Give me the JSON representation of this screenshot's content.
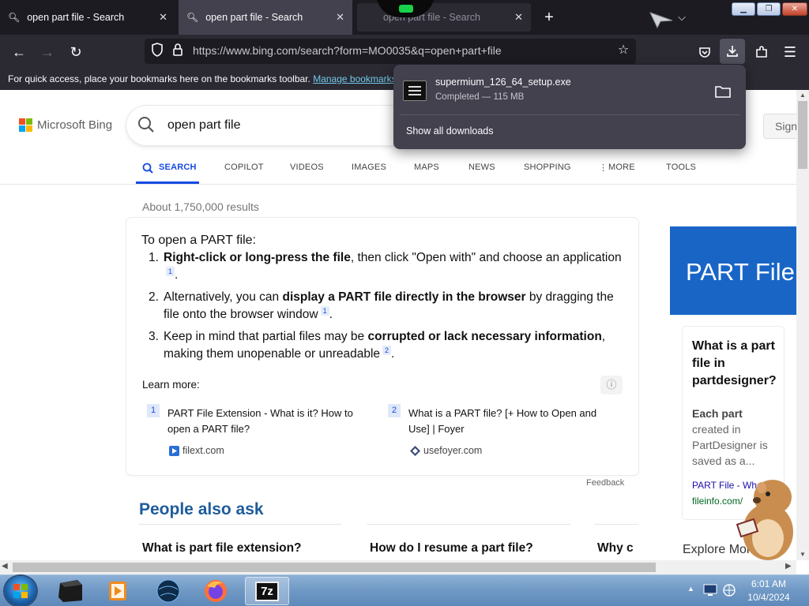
{
  "browser": {
    "tabs": [
      {
        "title": "open part file - Search",
        "icon": "search-icon",
        "active": false
      },
      {
        "title": "open part file - Search",
        "icon": "search-icon",
        "active": true
      },
      {
        "title": "open part file - Search",
        "icon": "spyware-icon",
        "active": false
      }
    ],
    "url": "https://www.bing.com/search?form=MO0035&q=open+part+file",
    "bookmarks_bar": {
      "text": "For quick access, place your bookmarks here on the bookmarks toolbar.",
      "link": "Manage bookmarks..."
    }
  },
  "downloads": {
    "filename": "supermium_126_64_setup.exe",
    "status": "Completed — 115 MB",
    "show_all": "Show all downloads"
  },
  "bing": {
    "logo": "Microsoft Bing",
    "query": "open part file",
    "sign_in": "Sign in",
    "scopes": [
      "SEARCH",
      "COPILOT",
      "VIDEOS",
      "IMAGES",
      "MAPS",
      "NEWS",
      "SHOPPING",
      "MORE",
      "TOOLS"
    ],
    "result_count": "About 1,750,000 results",
    "answer": {
      "intro": "To open a PART file:",
      "steps": [
        {
          "num": "1.",
          "bold": "Right-click or long-press the file",
          "rest": ", then click \"Open with\" and choose an application",
          "cite": "1",
          "tail": "."
        },
        {
          "num": "2.",
          "pre": "Alternatively, you can ",
          "bold": "display a PART file directly in the browser",
          "rest": " by dragging the file onto the browser window",
          "cite": "1",
          "tail": "."
        },
        {
          "num": "3.",
          "pre": "Keep in mind that partial files may be ",
          "bold": "corrupted or lack necessary information",
          "rest": ", making them unopenable or unreadable",
          "cite": "2",
          "tail": "."
        }
      ],
      "learn_more": "Learn more:",
      "refs": [
        {
          "num": "1",
          "title": "PART File Extension - What is it? How to open a PART file?",
          "site": "filext.com"
        },
        {
          "num": "2",
          "title": "What is a PART file? [+ How to Open and Use] | Foyer",
          "site": "usefoyer.com"
        }
      ],
      "feedback": "Feedback"
    },
    "people_also_ask": {
      "title": "People also ask",
      "questions": [
        "What is part file extension?",
        "How do I resume a part file?",
        "Why c"
      ]
    },
    "side_panel": {
      "banner": "PART File",
      "question": "What is a part file in partdesigner?",
      "answer_bold": "Each part",
      "answer": " created in PartDesigner is saved as a...",
      "link": "PART File - What",
      "site": "fileinfo.com/",
      "explore": "Explore More"
    }
  },
  "taskbar": {
    "time": "6:01 AM",
    "date": "10/4/2024",
    "apps": [
      "cube-app-icon",
      "media-player-icon",
      "globe-app-icon",
      "firefox-icon",
      "7zip-icon"
    ],
    "active_app_label": "7z"
  },
  "colors": {
    "accent": "#174ae4",
    "paa_title": "#1d5c9c",
    "side_banner": "#1865c6",
    "browser_chrome": "#2b2a33"
  }
}
